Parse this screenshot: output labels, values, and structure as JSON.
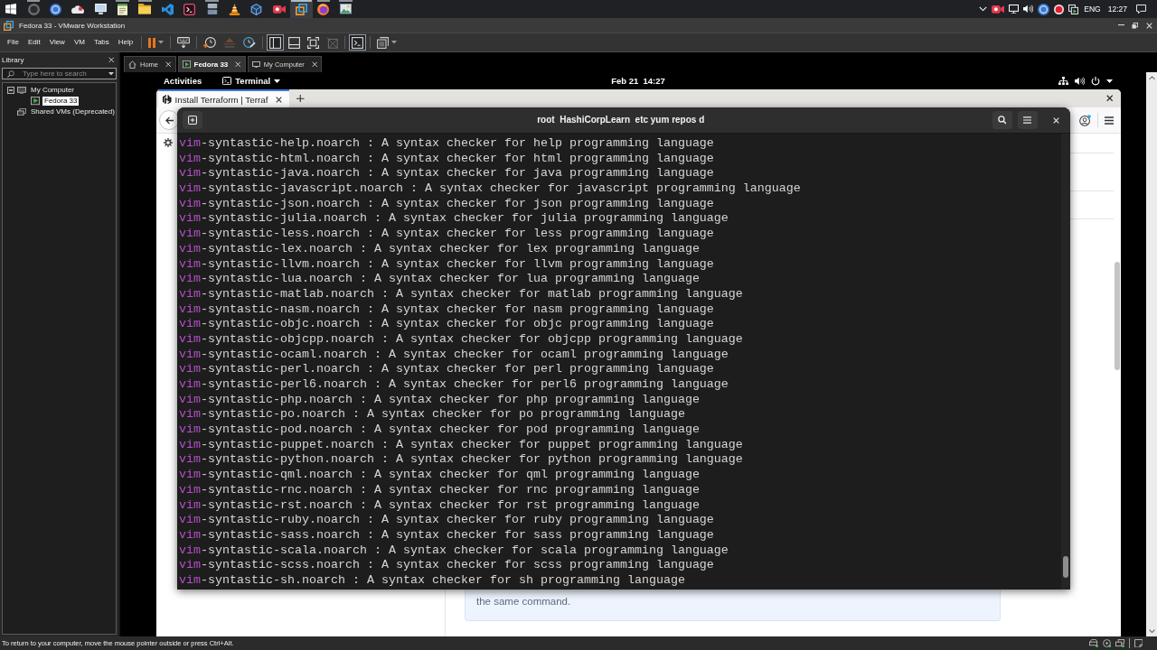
{
  "taskbar": {
    "apps": [
      {
        "kind": "start",
        "running": false,
        "active": false
      },
      {
        "kind": "ring",
        "running": true,
        "active": false
      },
      {
        "kind": "disc",
        "running": false,
        "active": false
      },
      {
        "kind": "cloud",
        "running": false,
        "active": false
      },
      {
        "kind": "monitor",
        "running": false,
        "active": false
      },
      {
        "kind": "notepad",
        "running": true,
        "active": false
      },
      {
        "kind": "folder",
        "running": true,
        "active": false
      },
      {
        "kind": "ribbon",
        "running": false,
        "active": false
      },
      {
        "kind": "terminal",
        "running": false,
        "active": false
      },
      {
        "kind": "server",
        "running": true,
        "active": false
      },
      {
        "kind": "cone",
        "running": false,
        "active": false
      },
      {
        "kind": "cube",
        "running": false,
        "active": false
      },
      {
        "kind": "camera",
        "running": false,
        "active": false
      },
      {
        "kind": "squares",
        "running": true,
        "active": true
      },
      {
        "kind": "globe",
        "running": true,
        "active": false
      },
      {
        "kind": "picture",
        "running": true,
        "active": false
      }
    ],
    "language": "ENG",
    "clock": "12:27"
  },
  "window": {
    "title": "Fedora 33 - VMware Workstation"
  },
  "menu": [
    "File",
    "Edit",
    "View",
    "VM",
    "Tabs",
    "Help"
  ],
  "toolbar": [
    [
      {
        "kind": "pause",
        "on": false,
        "disabled": false
      }
    ],
    [
      {
        "kind": "send_keys",
        "on": false,
        "disabled": false
      }
    ],
    [
      {
        "kind": "snapshot",
        "on": false,
        "disabled": false
      },
      {
        "kind": "revert",
        "on": false,
        "disabled": true
      },
      {
        "kind": "snapshot_manager",
        "on": false,
        "disabled": false
      }
    ],
    [
      {
        "kind": "library",
        "on": true,
        "disabled": false
      },
      {
        "kind": "thumbnails",
        "on": false,
        "disabled": false
      },
      {
        "kind": "full_screen",
        "on": false,
        "disabled": false
      },
      {
        "kind": "unity",
        "on": false,
        "disabled": true
      }
    ],
    [
      {
        "kind": "console",
        "on": true,
        "disabled": false
      }
    ],
    [
      {
        "kind": "stretch",
        "on": false,
        "disabled": false
      }
    ]
  ],
  "library": {
    "title": "Library",
    "search": {
      "placeholder": "Type here to search"
    },
    "tree": [
      {
        "label": "My Computer",
        "kind": "computer",
        "expanded": true,
        "selected": false,
        "children": [
          {
            "label": "Fedora 33",
            "kind": "vm",
            "selected": true
          }
        ]
      },
      {
        "label": "Shared VMs (Deprecated)",
        "kind": "shared",
        "selected": false
      }
    ]
  },
  "vm_tabs": [
    {
      "label": "Home",
      "kind": "home",
      "selected": false
    },
    {
      "label": "Fedora 33",
      "kind": "vm",
      "selected": true
    },
    {
      "label": "My Computer",
      "kind": "computer",
      "selected": false
    }
  ],
  "guest": {
    "top_bar": {
      "activities": "Activities",
      "app_menu": "Terminal",
      "clock": "Feb 21  14:27"
    },
    "browser": {
      "tabs": [
        {
          "title": "Install Terraform | Terraf",
          "selected": true
        }
      ],
      "note": "the same command."
    },
    "terminal": {
      "title": "root  HashiCorpLearn  etc yum repos d",
      "lines": [
        {
          "highlight": "vim",
          "text": "-syntastic-help.noarch : A syntax checker for help programming language"
        },
        {
          "highlight": "vim",
          "text": "-syntastic-html.noarch : A syntax checker for html programming language"
        },
        {
          "highlight": "vim",
          "text": "-syntastic-java.noarch : A syntax checker for java programming language"
        },
        {
          "highlight": "vim",
          "text": "-syntastic-javascript.noarch : A syntax checker for javascript programming language"
        },
        {
          "highlight": "vim",
          "text": "-syntastic-json.noarch : A syntax checker for json programming language"
        },
        {
          "highlight": "vim",
          "text": "-syntastic-julia.noarch : A syntax checker for julia programming language"
        },
        {
          "highlight": "vim",
          "text": "-syntastic-less.noarch : A syntax checker for less programming language"
        },
        {
          "highlight": "vim",
          "text": "-syntastic-lex.noarch : A syntax checker for lex programming language"
        },
        {
          "highlight": "vim",
          "text": "-syntastic-llvm.noarch : A syntax checker for llvm programming language"
        },
        {
          "highlight": "vim",
          "text": "-syntastic-lua.noarch : A syntax checker for lua programming language"
        },
        {
          "highlight": "vim",
          "text": "-syntastic-matlab.noarch : A syntax checker for matlab programming language"
        },
        {
          "highlight": "vim",
          "text": "-syntastic-nasm.noarch : A syntax checker for nasm programming language"
        },
        {
          "highlight": "vim",
          "text": "-syntastic-objc.noarch : A syntax checker for objc programming language"
        },
        {
          "highlight": "vim",
          "text": "-syntastic-objcpp.noarch : A syntax checker for objcpp programming language"
        },
        {
          "highlight": "vim",
          "text": "-syntastic-ocaml.noarch : A syntax checker for ocaml programming language"
        },
        {
          "highlight": "vim",
          "text": "-syntastic-perl.noarch : A syntax checker for perl programming language"
        },
        {
          "highlight": "vim",
          "text": "-syntastic-perl6.noarch : A syntax checker for perl6 programming language"
        },
        {
          "highlight": "vim",
          "text": "-syntastic-php.noarch : A syntax checker for php programming language"
        },
        {
          "highlight": "vim",
          "text": "-syntastic-po.noarch : A syntax checker for po programming language"
        },
        {
          "highlight": "vim",
          "text": "-syntastic-pod.noarch : A syntax checker for pod programming language"
        },
        {
          "highlight": "vim",
          "text": "-syntastic-puppet.noarch : A syntax checker for puppet programming language"
        },
        {
          "highlight": "vim",
          "text": "-syntastic-python.noarch : A syntax checker for python programming language"
        },
        {
          "highlight": "vim",
          "text": "-syntastic-qml.noarch : A syntax checker for qml programming language"
        },
        {
          "highlight": "vim",
          "text": "-syntastic-rnc.noarch : A syntax checker for rnc programming language"
        },
        {
          "highlight": "vim",
          "text": "-syntastic-rst.noarch : A syntax checker for rst programming language"
        },
        {
          "highlight": "vim",
          "text": "-syntastic-ruby.noarch : A syntax checker for ruby programming language"
        },
        {
          "highlight": "vim",
          "text": "-syntastic-sass.noarch : A syntax checker for sass programming language"
        },
        {
          "highlight": "vim",
          "text": "-syntastic-scala.noarch : A syntax checker for scala programming language"
        },
        {
          "highlight": "vim",
          "text": "-syntastic-scss.noarch : A syntax checker for scss programming language"
        },
        {
          "highlight": "vim",
          "text": "-syntastic-sh.noarch : A syntax checker for sh programming language"
        }
      ]
    }
  },
  "status_bar": {
    "message": "To return to your computer, move the mouse pointer outside or press Ctrl+Alt."
  }
}
